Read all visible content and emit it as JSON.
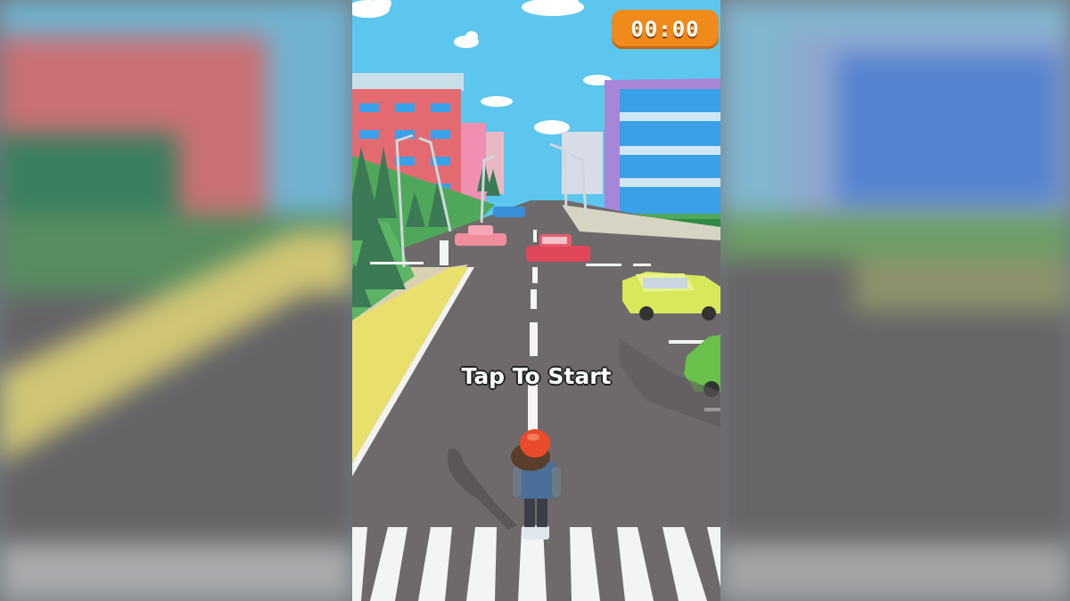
{
  "hud": {
    "timer_text": "00:00",
    "prompt_text": "Tap To Start"
  },
  "colors": {
    "sky": "#5cc6ee",
    "road": "#6e6a6c",
    "grass": "#4fa85a",
    "timer": "#f08a1b",
    "building_red": "#e46a72",
    "building_blue": "#3aa0e8",
    "car_red": "#e0475a",
    "car_yellow": "#d8e85a",
    "car_green": "#6ac04a",
    "player_helmet": "#e84a2a"
  }
}
